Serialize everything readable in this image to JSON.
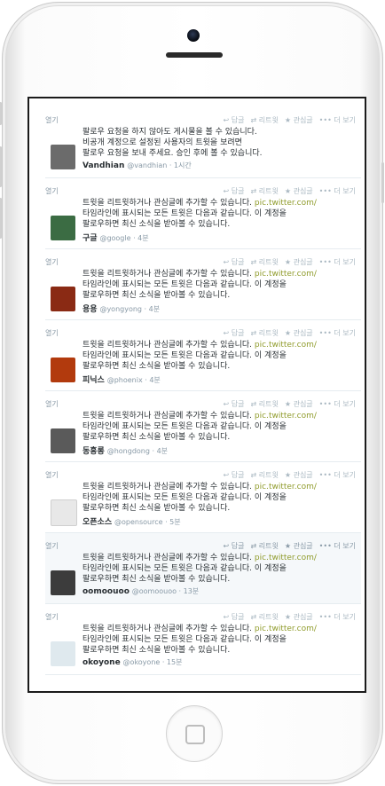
{
  "toolbar": {
    "reply_label": "답글",
    "retweet_label": "리트윗",
    "favorite_label": "관심글",
    "more_label": "더 보기",
    "expand_label": "열기"
  },
  "tweets": [
    {
      "line1": "팔로우 요청을 하지 않아도 게시물을 볼 수 있습니다.",
      "line2": "비공개 계정으로 설정된 사용자의 트윗을 보려면",
      "line3": "팔로우 요청을 보내 주세요. 승인 후에 볼 수 있습니다.",
      "link": "",
      "name": "Vandhian",
      "screen_name": "@vandhian · 1시간",
      "avatar_color": "#6b6b6b"
    },
    {
      "line1": "트윗을 리트윗하거나 관심글에 추가할 수 있습니다. pic.twitter.com/",
      "line2": "타임라인에 표시되는 모든 트윗은 다음과 같습니다. 이 계정을",
      "line3": "팔로우하면 최신 소식을 받아볼 수 있습니다.",
      "link": "pic.twitter.com/",
      "name": "구글",
      "screen_name": "@google · 4분",
      "avatar_color": "#3b6c43"
    },
    {
      "line1": "트윗을 리트윗하거나 관심글에 추가할 수 있습니다. pic.twitter.com/",
      "line2": "타임라인에 표시되는 모든 트윗은 다음과 같습니다. 이 계정을",
      "line3": "팔로우하면 최신 소식을 받아볼 수 있습니다.",
      "link": "pic.twitter.com/",
      "name": "용용",
      "screen_name": "@yongyong · 4분",
      "avatar_color": "#8a2a14"
    },
    {
      "line1": "트윗을 리트윗하거나 관심글에 추가할 수 있습니다. pic.twitter.com/",
      "line2": "타임라인에 표시되는 모든 트윗은 다음과 같습니다. 이 계정을",
      "line3": "팔로우하면 최신 소식을 받아볼 수 있습니다.",
      "link": "pic.twitter.com/",
      "name": "피닉스",
      "screen_name": "@phoenix · 4분",
      "avatar_color": "#b23a0d"
    },
    {
      "line1": "트윗을 리트윗하거나 관심글에 추가할 수 있습니다. pic.twitter.com/",
      "line2": "타임라인에 표시되는 모든 트윗은 다음과 같습니다. 이 계정을",
      "line3": "팔로우하면 최신 소식을 받아볼 수 있습니다.",
      "link": "pic.twitter.com/",
      "name": "동흥롱",
      "screen_name": "@hongdong · 4분",
      "avatar_color": "#5a5a5a"
    },
    {
      "line1": "트윗을 리트윗하거나 관심글에 추가할 수 있습니다. pic.twitter.com/",
      "line2": "타임라인에 표시되는 모든 트윗은 다음과 같습니다. 이 계정을",
      "line3": "팔로우하면 최신 소식을 받아볼 수 있습니다.",
      "link": "pic.twitter.com/",
      "name": "오픈소스",
      "screen_name": "@opensource · 5분",
      "avatar_color": "#e8e8e8"
    },
    {
      "line1": "트윗을 리트윗하거나 관심글에 추가할 수 있습니다. pic.twitter.com/",
      "line2": "타임라인에 표시되는 모든 트윗은 다음과 같습니다. 이 계정을",
      "line3": "팔로우하면 최신 소식을 받아볼 수 있습니다.",
      "link": "pic.twitter.com/",
      "name": "oomoouoo",
      "screen_name": "@oomoouoo · 13분",
      "avatar_color": "#3c3c3c"
    },
    {
      "line1": "트윗을 리트윗하거나 관심글에 추가할 수 있습니다. pic.twitter.com/",
      "line2": "타임라인에 표시되는 모든 트윗은 다음과 같습니다. 이 계정을",
      "line3": "팔로우하면 최신 소식을 받아볼 수 있습니다.",
      "link": "pic.twitter.com/",
      "name": "okoyone",
      "screen_name": "@okoyone · 15분",
      "avatar_color": "#dfe9ee"
    }
  ]
}
